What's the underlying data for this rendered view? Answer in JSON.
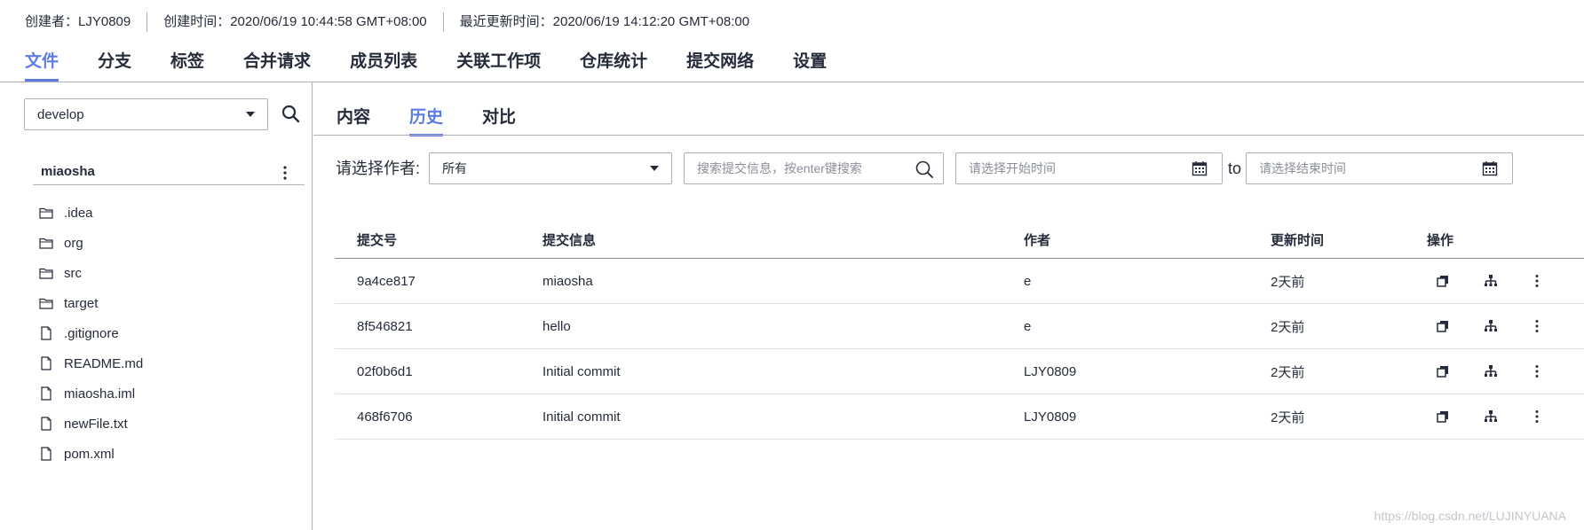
{
  "meta": {
    "creator": "创建者：LJY0809",
    "created": "创建时间：2020/06/19 10:44:58 GMT+08:00",
    "updated": "最近更新时间：2020/06/19 14:12:20 GMT+08:00"
  },
  "main_tabs": [
    "文件",
    "分支",
    "标签",
    "合并请求",
    "成员列表",
    "关联工作项",
    "仓库统计",
    "提交网络",
    "设置"
  ],
  "main_tab_active": "文件",
  "sidebar": {
    "branch": "develop",
    "repo_name": "miaosha",
    "files": [
      {
        "name": ".idea",
        "type": "folder"
      },
      {
        "name": "org",
        "type": "folder"
      },
      {
        "name": "src",
        "type": "folder"
      },
      {
        "name": "target",
        "type": "folder"
      },
      {
        "name": ".gitignore",
        "type": "file"
      },
      {
        "name": "README.md",
        "type": "file"
      },
      {
        "name": "miaosha.iml",
        "type": "file"
      },
      {
        "name": "newFile.txt",
        "type": "file"
      },
      {
        "name": "pom.xml",
        "type": "file"
      }
    ]
  },
  "sub_tabs": [
    "内容",
    "历史",
    "对比"
  ],
  "sub_tab_active": "历史",
  "filters": {
    "author_label": "请选择作者:",
    "author_value": "所有",
    "search_placeholder": "搜索提交信息，按enter键搜索",
    "start_placeholder": "请选择开始时间",
    "to_label": "to",
    "end_placeholder": "请选择结束时间"
  },
  "table": {
    "headers": {
      "id": "提交号",
      "message": "提交信息",
      "author": "作者",
      "time": "更新时间",
      "ops": "操作"
    },
    "rows": [
      {
        "id": "9a4ce817",
        "message": "miaosha",
        "author": "e",
        "time": "2天前"
      },
      {
        "id": "8f546821",
        "message": "hello",
        "author": "e",
        "time": "2天前"
      },
      {
        "id": "02f0b6d1",
        "message": "Initial commit",
        "author": "LJY0809",
        "time": "2天前"
      },
      {
        "id": "468f6706",
        "message": "Initial commit",
        "author": "LJY0809",
        "time": "2天前"
      }
    ]
  },
  "colors": {
    "accent": "#5e7ce0",
    "text": "#252b3a",
    "border": "#adb0b8",
    "placeholder": "#8a8e99"
  },
  "icons": {
    "branch_search": "search-icon",
    "repo_menu": "kebab-menu-icon",
    "folder": "folder-icon",
    "file": "file-icon",
    "author_dropdown": "chevron-down-icon",
    "search": "search-icon",
    "date": "calendar-icon",
    "row_ops": [
      "copy-icon",
      "tree-icon",
      "more-icon"
    ]
  },
  "watermark": "https://blog.csdn.net/LUJINYUANA"
}
